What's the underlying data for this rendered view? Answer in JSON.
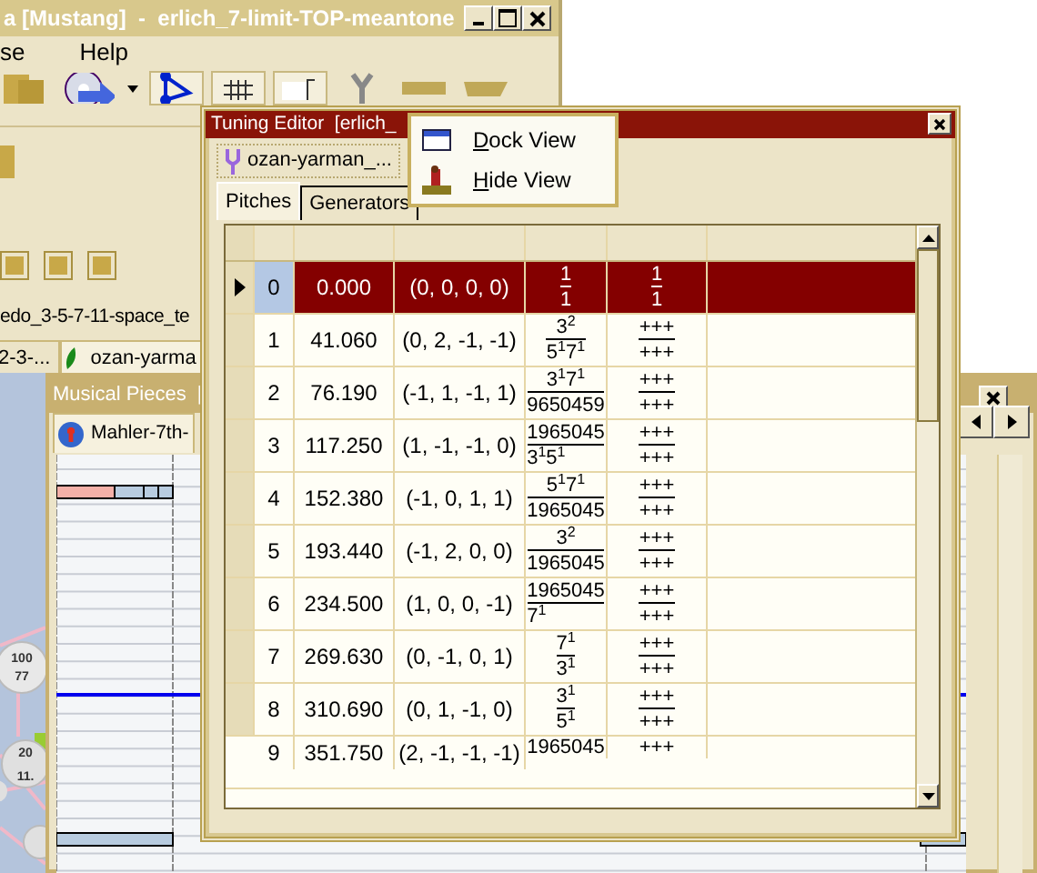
{
  "main_window": {
    "title": "a [Mustang]  -  erlich_7-limit-TOP-meantone",
    "menu": [
      "se",
      "Help"
    ]
  },
  "left_panel": {
    "scale_tab": "edo_3-5-7-11-space_te",
    "tabs": [
      {
        "label": "2-3-...",
        "selected": false
      },
      {
        "label": "ozan-yarma",
        "selected": true
      }
    ]
  },
  "lattice": {
    "nodes": [
      {
        "numerator": "100",
        "denominator": "77"
      },
      {
        "numerator": "20",
        "denominator": "11."
      }
    ]
  },
  "musical_pieces": {
    "title": "Musical Pieces  [",
    "tab": "Mahler-7th-"
  },
  "tuning_editor": {
    "title": "Tuning Editor  [erlich_",
    "scale_tab": "ozan-yarman_...",
    "tabs": [
      {
        "label": "Pitches",
        "selected": true
      },
      {
        "label": "Generators",
        "selected": false
      }
    ],
    "rows": [
      {
        "index": "0",
        "cents": "0.000",
        "vector": "(0, 0, 0, 0)",
        "ratio_num": "1",
        "ratio_den": "1",
        "column_5_num": "1",
        "column_5_den": "1",
        "selected": true
      },
      {
        "index": "1",
        "cents": "41.060",
        "vector": "(0, 2, -1, -1)",
        "ratio_num": "3$^{2}$",
        "ratio_den": "5$^{1}$7$^{1}$",
        "column_5_num": "+++",
        "column_5_den": "+++",
        "selected": false
      },
      {
        "index": "2",
        "cents": "76.190",
        "vector": "(-1, 1, -1, 1)",
        "ratio_num": "3$^{1}$7$^{1}$",
        "ratio_den": "9650459",
        "column_5_num": "+++",
        "column_5_den": "+++",
        "selected": false
      },
      {
        "index": "3",
        "cents": "117.250",
        "vector": "(1, -1, -1, 0)",
        "ratio_num": "1965045",
        "ratio_den": "3$^{1}$5$^{1}$",
        "column_5_num": "+++",
        "column_5_den": "+++",
        "selected": false
      },
      {
        "index": "4",
        "cents": "152.380",
        "vector": "(-1, 0, 1, 1)",
        "ratio_num": "5$^{1}$7$^{1}$",
        "ratio_den": "1965045",
        "column_5_num": "+++",
        "column_5_den": "+++",
        "selected": false
      },
      {
        "index": "5",
        "cents": "193.440",
        "vector": "(-1, 2, 0, 0)",
        "ratio_num": "3$^{2}$",
        "ratio_den": "1965045",
        "column_5_num": "+++",
        "column_5_den": "+++",
        "selected": false
      },
      {
        "index": "6",
        "cents": "234.500",
        "vector": "(1, 0, 0, -1)",
        "ratio_num": "1965045",
        "ratio_den": "7$^{1}$",
        "column_5_num": "+++",
        "column_5_den": "+++",
        "selected": false
      },
      {
        "index": "7",
        "cents": "269.630",
        "vector": "(0, -1, 0, 1)",
        "ratio_num": "7$^{1}$",
        "ratio_den": "3$^{1}$",
        "column_5_num": "+++",
        "column_5_den": "+++",
        "selected": false
      },
      {
        "index": "8",
        "cents": "310.690",
        "vector": "(0, 1, -1, 0)",
        "ratio_num": "3$^{1}$",
        "ratio_den": "5$^{1}$",
        "column_5_num": "+++",
        "column_5_den": "+++",
        "selected": false
      },
      {
        "index": "9",
        "cents": "351.750",
        "vector": "(2, -1, -1, -1)",
        "ratio_num": "1965045",
        "column_5_num": "+++",
        "selected": false
      }
    ]
  },
  "context_menu": [
    {
      "kind": "dock",
      "label": "Dock View"
    },
    {
      "kind": "hide",
      "label": "Hide View"
    }
  ]
}
